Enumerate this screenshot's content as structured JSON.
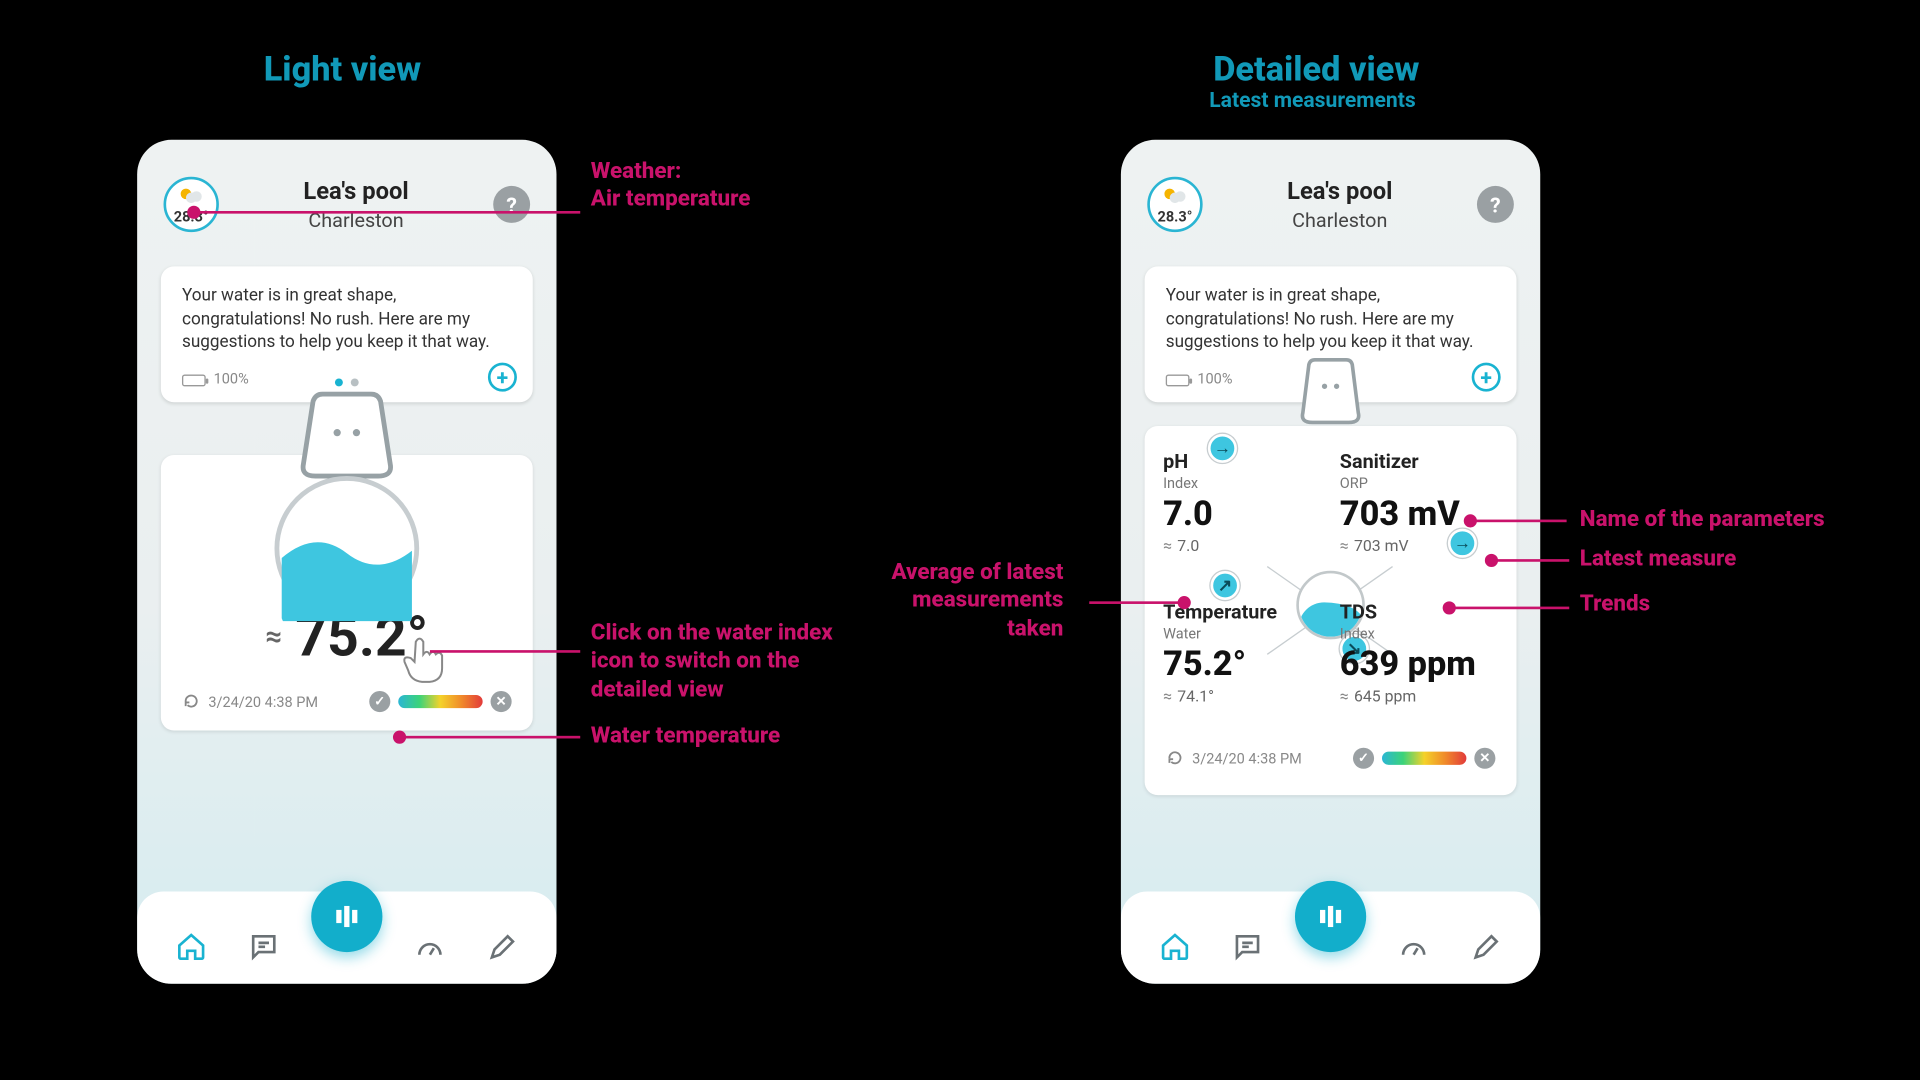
{
  "titles": {
    "light": "Light view",
    "detailed": "Detailed view",
    "detailed_sub": "Latest measurements"
  },
  "header": {
    "air_temp": "28.3°",
    "pool_name": "Lea's pool",
    "location": "Charleston",
    "help": "?"
  },
  "status": {
    "message": "Your water is in great shape, congratulations! No rush. Here are my suggestions to help you keep it that way.",
    "battery": "100%",
    "plus": "+"
  },
  "light": {
    "water_temp": "75.2°",
    "timestamp": "3/24/20 4:38 PM"
  },
  "detailed": {
    "timestamp": "3/24/20 4:38 PM",
    "ph": {
      "label": "pH",
      "sub": "Index",
      "value": "7.0",
      "avg": "7.0"
    },
    "sanitizer": {
      "label": "Sanitizer",
      "sub": "ORP",
      "value": "703 mV",
      "avg": "703 mV"
    },
    "temperature": {
      "label": "Temperature",
      "sub": "Water",
      "value": "75.2°",
      "avg": "74.1°"
    },
    "tds": {
      "label": "TDS",
      "sub": "Index",
      "value": "639 ppm",
      "avg": "645 ppm"
    }
  },
  "callouts": {
    "weather": "Weather:\nAir temperature",
    "click_water": "Click on the water index\nicon to switch on the\ndetailed view",
    "water_temp": "Water temperature",
    "avg": "Average of latest\nmeasurements\ntaken",
    "param_name": "Name of the parameters",
    "latest": "Latest measure",
    "trends": "Trends"
  },
  "foot_icons": {
    "check": "✓",
    "close": "✕"
  }
}
